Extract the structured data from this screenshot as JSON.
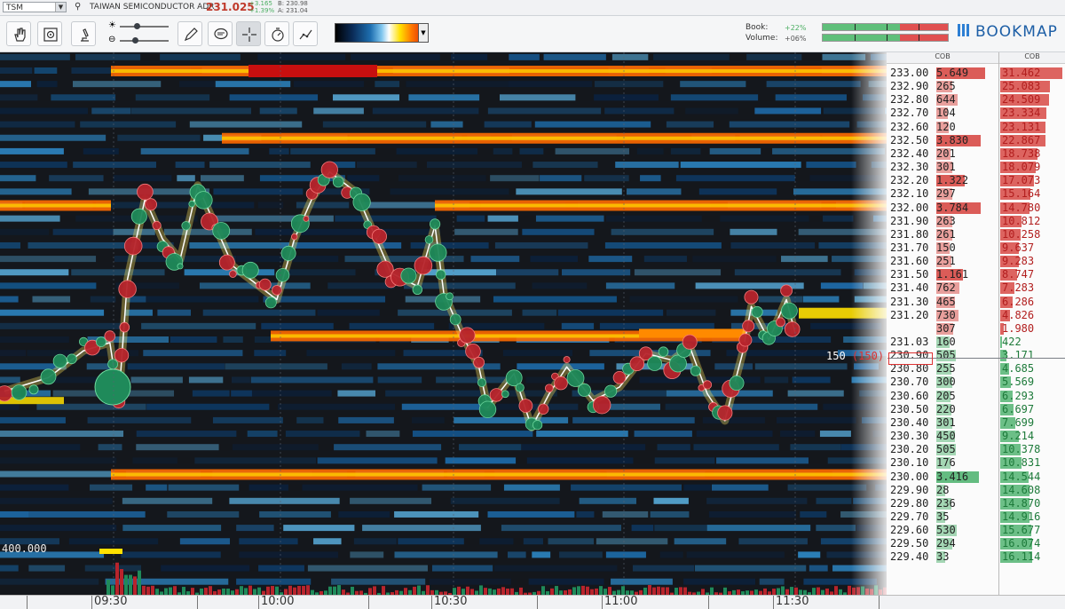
{
  "infobar": {
    "symbol": "TSM",
    "instrument_name": "TAIWAN SEMICONDUCTOR ADR",
    "last_price": "231.025",
    "change_abs": "+3.165",
    "change_pct": "+1.39%",
    "bid": "B: 230.98",
    "ask": "A: 231.04"
  },
  "toolbar": {
    "tools": [
      "hand-tool",
      "zoom-tool",
      "microscope-tool",
      "brightness-slider",
      "contrast-slider",
      "pencil-tool",
      "comment-tool",
      "crosshair-tool",
      "stopwatch-tool",
      "indicator-tool"
    ],
    "book_label": "Book:",
    "book_value": "+22%",
    "volume_label": "Volume:",
    "volume_value": "+06%",
    "book_meter": {
      "green": 0.62,
      "red": 0.38
    },
    "volume_meter": {
      "green": 0.62,
      "red": 0.38
    },
    "logo": "BOOKMAP",
    "colors": {
      "accent": "#2d7fd3",
      "positive": "#4caf63",
      "price": "#c0392b"
    }
  },
  "ladder": {
    "header_left": "COB",
    "header_right": "COB",
    "rows": [
      {
        "price": "233.00",
        "book": "5.649",
        "cob": "31.462",
        "side": "sell"
      },
      {
        "price": "232.90",
        "book": "265",
        "cob": "25.083",
        "side": "sell"
      },
      {
        "price": "232.80",
        "book": "644",
        "cob": "24.509",
        "side": "sell"
      },
      {
        "price": "232.70",
        "book": "104",
        "cob": "23.334",
        "side": "sell"
      },
      {
        "price": "232.60",
        "book": "120",
        "cob": "23.131",
        "side": "sell"
      },
      {
        "price": "232.50",
        "book": "3.830",
        "cob": "22.867",
        "side": "sell"
      },
      {
        "price": "232.40",
        "book": "201",
        "cob": "18.738",
        "side": "sell"
      },
      {
        "price": "232.30",
        "book": "301",
        "cob": "18.079",
        "side": "sell"
      },
      {
        "price": "232.20",
        "book": "1.322",
        "cob": "17.073",
        "side": "sell"
      },
      {
        "price": "232.10",
        "book": "297",
        "cob": "15.164",
        "side": "sell"
      },
      {
        "price": "232.00",
        "book": "3.784",
        "cob": "14.780",
        "side": "sell"
      },
      {
        "price": "231.90",
        "book": "263",
        "cob": "10.812",
        "side": "sell"
      },
      {
        "price": "231.80",
        "book": "261",
        "cob": "10.258",
        "side": "sell"
      },
      {
        "price": "231.70",
        "book": "150",
        "cob": "9.637",
        "side": "sell"
      },
      {
        "price": "231.60",
        "book": "251",
        "cob": "9.283",
        "side": "sell"
      },
      {
        "price": "231.50",
        "book": "1.161",
        "cob": "8.747",
        "side": "sell"
      },
      {
        "price": "231.40",
        "book": "762",
        "cob": "7.283",
        "side": "sell"
      },
      {
        "price": "231.30",
        "book": "465",
        "cob": "6.286",
        "side": "sell"
      },
      {
        "price": "231.20",
        "book": "730",
        "cob": "4.826",
        "side": "sell"
      },
      {
        "price": "",
        "book": "307",
        "cob": "1.980",
        "side": "sell"
      },
      {
        "price": "231.03",
        "book": "160",
        "cob": "422",
        "side": "buy"
      },
      {
        "price": "230.90",
        "book": "505",
        "cob": "3.171",
        "side": "buy"
      },
      {
        "price": "230.80",
        "book": "255",
        "cob": "4.685",
        "side": "buy"
      },
      {
        "price": "230.70",
        "book": "300",
        "cob": "5.569",
        "side": "buy"
      },
      {
        "price": "230.60",
        "book": "205",
        "cob": "6.293",
        "side": "buy"
      },
      {
        "price": "230.50",
        "book": "220",
        "cob": "6.697",
        "side": "buy"
      },
      {
        "price": "230.40",
        "book": "301",
        "cob": "7.699",
        "side": "buy"
      },
      {
        "price": "230.30",
        "book": "450",
        "cob": "9.214",
        "side": "buy"
      },
      {
        "price": "230.20",
        "book": "505",
        "cob": "10.378",
        "side": "buy"
      },
      {
        "price": "230.10",
        "book": "176",
        "cob": "10.831",
        "side": "buy"
      },
      {
        "price": "230.00",
        "book": "3.416",
        "cob": "14.544",
        "side": "buy"
      },
      {
        "price": "229.90",
        "book": "28",
        "cob": "14.608",
        "side": "buy"
      },
      {
        "price": "229.80",
        "book": "236",
        "cob": "14.870",
        "side": "buy"
      },
      {
        "price": "229.70",
        "book": "35",
        "cob": "14.916",
        "side": "buy"
      },
      {
        "price": "229.60",
        "book": "530",
        "cob": "15.677",
        "side": "buy"
      },
      {
        "price": "229.50",
        "book": "294",
        "cob": "16.074",
        "side": "buy"
      },
      {
        "price": "229.40",
        "book": "33",
        "cob": "16.114",
        "side": "buy"
      }
    ],
    "last_trade_size": "150",
    "last_trade_size_red": "(150)"
  },
  "chart_data": {
    "type": "heatmap",
    "price_range": [
      229.4,
      233.0
    ],
    "time_labels": [
      "09:30",
      "10:00",
      "10:30",
      "11:00",
      "11:30"
    ],
    "volume_label": "400.000",
    "large_order_levels": [
      233.0,
      232.5,
      232.0,
      231.03,
      230.0
    ],
    "price_path": [
      {
        "t": 0.0,
        "p": 230.62
      },
      {
        "t": 0.05,
        "p": 230.72
      },
      {
        "t": 0.09,
        "p": 230.92
      },
      {
        "t": 0.12,
        "p": 230.98
      },
      {
        "t": 0.13,
        "p": 230.55
      },
      {
        "t": 0.14,
        "p": 231.45
      },
      {
        "t": 0.16,
        "p": 232.05
      },
      {
        "t": 0.18,
        "p": 231.75
      },
      {
        "t": 0.2,
        "p": 231.6
      },
      {
        "t": 0.22,
        "p": 232.15
      },
      {
        "t": 0.24,
        "p": 231.85
      },
      {
        "t": 0.26,
        "p": 231.55
      },
      {
        "t": 0.29,
        "p": 231.4
      },
      {
        "t": 0.31,
        "p": 231.3
      },
      {
        "t": 0.33,
        "p": 231.75
      },
      {
        "t": 0.35,
        "p": 232.05
      },
      {
        "t": 0.37,
        "p": 232.25
      },
      {
        "t": 0.4,
        "p": 232.1
      },
      {
        "t": 0.42,
        "p": 231.8
      },
      {
        "t": 0.44,
        "p": 231.5
      },
      {
        "t": 0.47,
        "p": 231.4
      },
      {
        "t": 0.49,
        "p": 231.85
      },
      {
        "t": 0.5,
        "p": 231.35
      },
      {
        "t": 0.52,
        "p": 231.05
      },
      {
        "t": 0.54,
        "p": 230.8
      },
      {
        "t": 0.55,
        "p": 230.5
      },
      {
        "t": 0.58,
        "p": 230.75
      },
      {
        "t": 0.6,
        "p": 230.35
      },
      {
        "t": 0.62,
        "p": 230.6
      },
      {
        "t": 0.64,
        "p": 230.8
      },
      {
        "t": 0.67,
        "p": 230.55
      },
      {
        "t": 0.7,
        "p": 230.65
      },
      {
        "t": 0.73,
        "p": 230.9
      },
      {
        "t": 0.76,
        "p": 230.85
      },
      {
        "t": 0.78,
        "p": 230.95
      },
      {
        "t": 0.8,
        "p": 230.6
      },
      {
        "t": 0.82,
        "p": 230.4
      },
      {
        "t": 0.84,
        "p": 230.9
      },
      {
        "t": 0.85,
        "p": 231.25
      },
      {
        "t": 0.87,
        "p": 231.0
      },
      {
        "t": 0.89,
        "p": 231.3
      },
      {
        "t": 0.9,
        "p": 231.05
      }
    ]
  }
}
